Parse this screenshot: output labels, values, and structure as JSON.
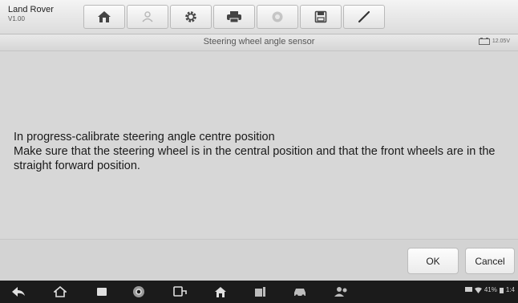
{
  "header": {
    "vehicle_name": "Land Rover",
    "version": "V1.00"
  },
  "toolbar": {
    "buttons": [
      {
        "icon": "home-icon",
        "enabled": true
      },
      {
        "icon": "vehicle-swap-icon",
        "enabled": false
      },
      {
        "icon": "settings-gear-icon",
        "enabled": true
      },
      {
        "icon": "print-icon",
        "enabled": true
      },
      {
        "icon": "help-icon",
        "enabled": false
      },
      {
        "icon": "save-icon",
        "enabled": true
      },
      {
        "icon": "data-logging-pen-icon",
        "enabled": true
      }
    ]
  },
  "titlebar": {
    "title": "Steering wheel angle sensor",
    "voltage": "12.05V"
  },
  "message": {
    "line1": "In progress-calibrate steering angle centre position",
    "line2": "Make sure that the steering wheel is in the central position and that the front wheels are in the straight forward position."
  },
  "actions": {
    "ok_label": "OK",
    "cancel_label": "Cancel"
  },
  "system_bar": {
    "icons": [
      "back-icon",
      "home-icon",
      "recent-apps-icon",
      "chrome-icon",
      "vci-connect-icon",
      "diagnostics-home-icon",
      "vehicle-service-icon",
      "vehicle-icon",
      "users-icon"
    ],
    "battery_percent": "41%",
    "time": "1:4"
  },
  "colors": {
    "background": "#d9d9d9",
    "navbar": "#1b1b1b"
  }
}
